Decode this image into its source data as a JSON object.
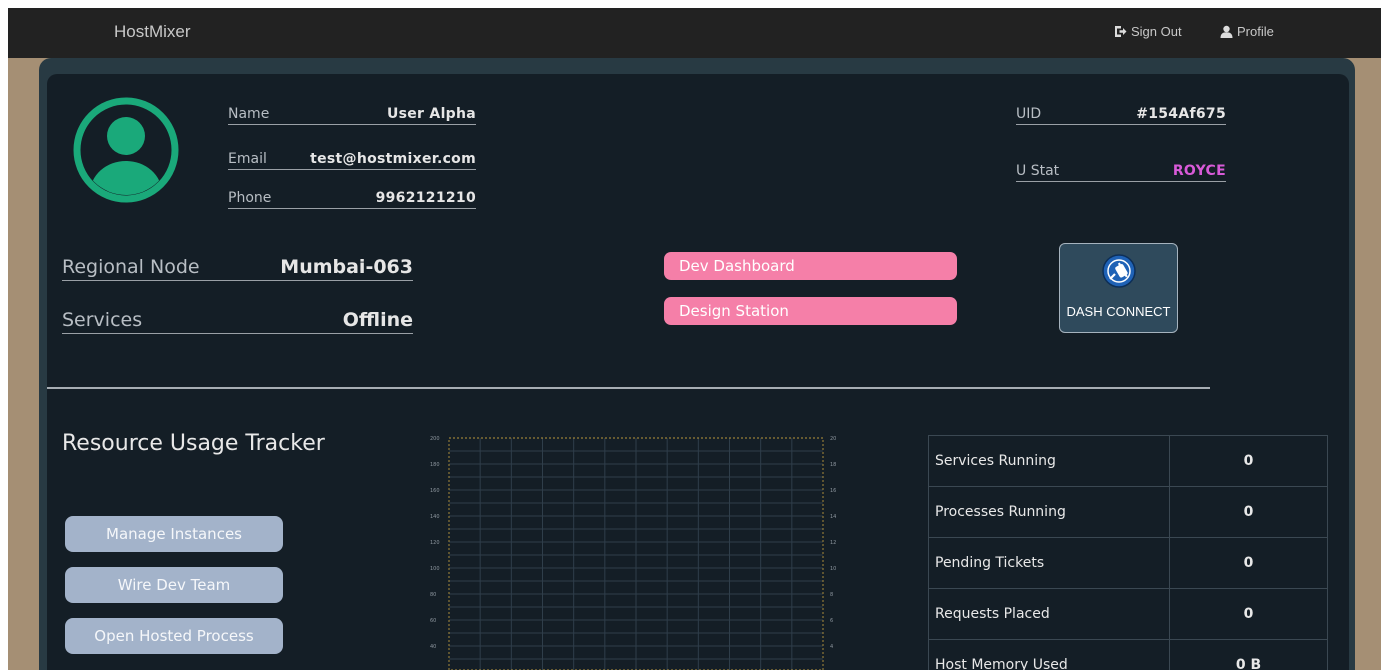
{
  "navbar": {
    "brand": "HostMixer",
    "sign_out": "Sign Out",
    "sign_out_icon": "sign-out-icon",
    "profile": "Profile",
    "profile_icon": "user-icon"
  },
  "profile": {
    "avatar_icon": "user-avatar-icon",
    "name_label": "Name",
    "name_value": "User Alpha",
    "email_label": "Email",
    "email_value": "test@hostmixer.com",
    "phone_label": "Phone",
    "phone_value": "9962121210",
    "uid_label": "UID",
    "uid_value": "#154Af675",
    "ustat_label": "U Stat",
    "ustat_value": "ROYCE",
    "region_label": "Regional Node",
    "region_value": "Mumbai-063",
    "services_label": "Services",
    "services_value": "Offline"
  },
  "quick_links": {
    "dev_dashboard": "Dev Dashboard",
    "design_station": "Design Station"
  },
  "dash_connect": {
    "label": "DASH CONNECT",
    "icon": "plug-icon"
  },
  "tracker": {
    "title": "Resource Usage Tracker",
    "buttons": [
      "Manage Instances",
      "Wire Dev Team",
      "Open Hosted Process"
    ]
  },
  "chart_data": {
    "type": "line",
    "title": "",
    "left_axis_ticks": [
      200,
      180,
      160,
      140,
      120,
      100,
      80,
      60,
      40,
      20
    ],
    "right_axis_ticks": [
      20,
      18,
      16,
      14,
      12,
      10,
      8,
      6,
      4,
      2
    ],
    "ylim_left": [
      0,
      200
    ],
    "ylim_right": [
      0,
      20
    ],
    "series": [],
    "grid": true
  },
  "stats": [
    {
      "label": "Services Running",
      "value": "0"
    },
    {
      "label": "Processes Running",
      "value": "0"
    },
    {
      "label": "Pending Tickets",
      "value": "0"
    },
    {
      "label": "Requests Placed",
      "value": "0"
    },
    {
      "label": "Host Memory Used",
      "value": "0 B"
    }
  ],
  "colors": {
    "navbar": "#222222",
    "panel": "#141e26",
    "accent_pink": "#f57fa8",
    "button_blue": "#a3b3ca",
    "avatar_green": "#1aa97a",
    "ustat_purple": "#d85ad8"
  }
}
